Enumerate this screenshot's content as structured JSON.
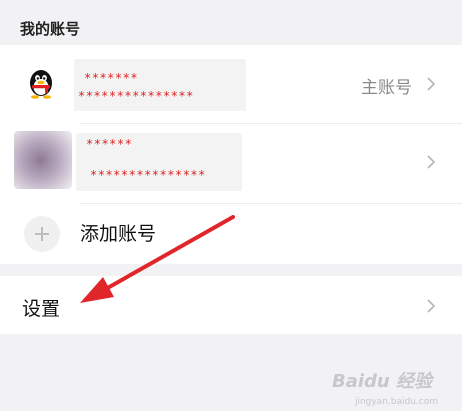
{
  "section": {
    "title": "我的账号"
  },
  "accounts": [
    {
      "masked_name": "*******",
      "masked_number": "***************",
      "badge": "主账号",
      "avatar": "qq-penguin-icon"
    },
    {
      "masked_name": "******",
      "masked_number": "***************",
      "badge": "",
      "avatar": "blurred-avatar"
    }
  ],
  "add_account": {
    "label": "添加账号"
  },
  "settings": {
    "label": "设置"
  },
  "watermark": {
    "text": "Baidu 经验",
    "sub": "jingyan.baidu.com"
  },
  "colors": {
    "mask_text": "#e02020",
    "arrow": "#e0262b",
    "background": "#f2f2f4"
  }
}
